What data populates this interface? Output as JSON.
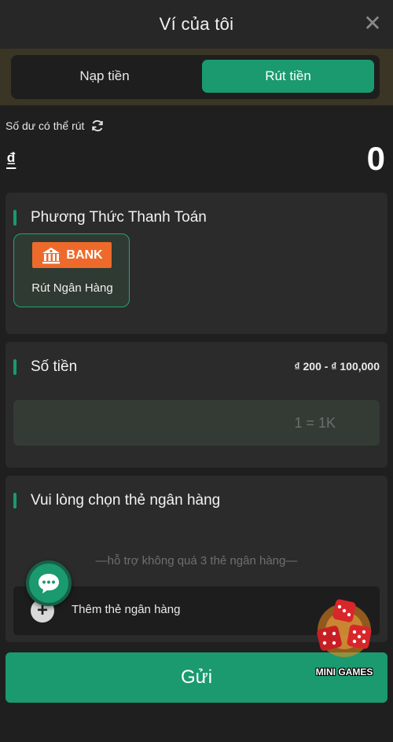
{
  "header": {
    "title": "Ví của tôi"
  },
  "tabs": [
    {
      "label": "Nạp tiền",
      "active": false
    },
    {
      "label": "Rút tiền",
      "active": true
    }
  ],
  "balance": {
    "label": "Số dư có thể rút",
    "currency_symbol": "₫",
    "amount": "0"
  },
  "payment_method": {
    "title": "Phương Thức Thanh Toán",
    "logo_text": "BANK",
    "option_label": "Rút Ngân Hàng"
  },
  "amount_section": {
    "title": "Số tiền",
    "range": "₫ 200 - ₫ 100,000",
    "input_placeholder": "1 = 1K"
  },
  "bank_card_section": {
    "title": "Vui lòng chọn thẻ ngân hàng",
    "hint": "—hỗ trợ không quá 3 thẻ ngân hàng—",
    "add_label": "Thêm thẻ ngân hàng"
  },
  "submit_label": "Gửi",
  "mini_games_label": "MINI GAMES",
  "colors": {
    "accent": "#1a9a6e",
    "background": "#1f1f1f",
    "card": "#2b2b2b",
    "bank_logo": "#ee6a2b"
  }
}
